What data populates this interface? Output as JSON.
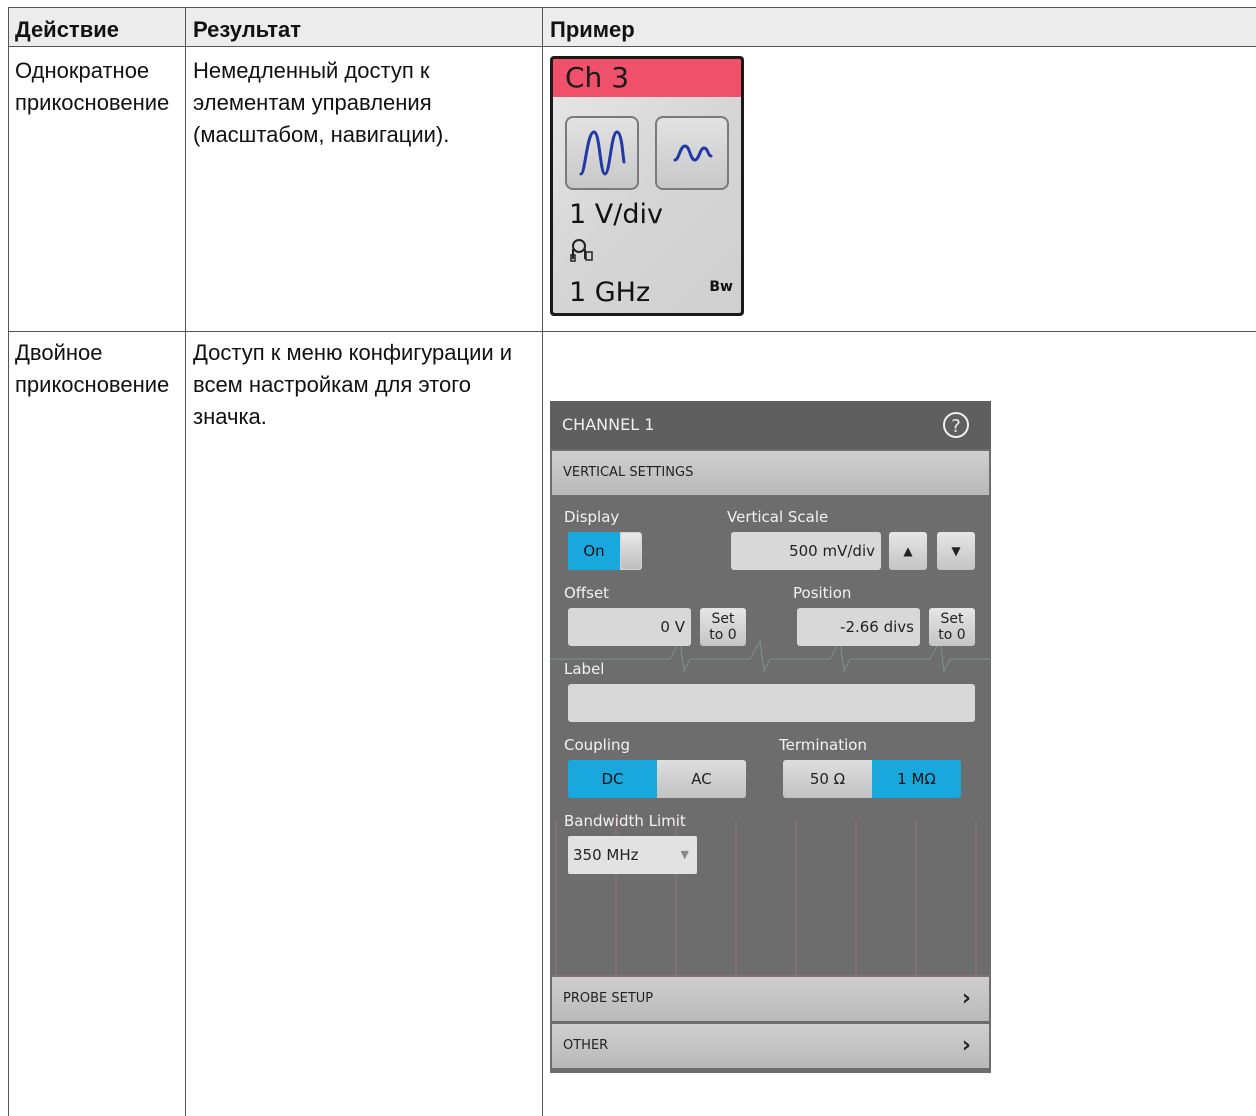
{
  "table": {
    "headers": [
      "Действие",
      "Результат",
      "Пример"
    ],
    "rows": [
      {
        "action_lines": [
          "Однократное",
          "прикосновение"
        ],
        "result_lines": [
          "Немедленный доступ к",
          "элементам управления",
          "(масштабом, навигации)."
        ]
      },
      {
        "action_lines": [
          "Двойное",
          "прикосновение"
        ],
        "result_lines": [
          "Доступ к меню конфигурации и",
          "всем настройкам для этого",
          "значка."
        ]
      }
    ]
  },
  "badge": {
    "title": "Ch 3",
    "scale": "1 V/div",
    "bandwidth": "1 GHz",
    "bw_label": "Bw",
    "title_color": "#f0506a"
  },
  "panel": {
    "title": "CHANNEL 1",
    "help_glyph": "?",
    "vertical_settings": "VERTICAL SETTINGS",
    "display_label": "Display",
    "display_on": "On",
    "vertical_scale_label": "Vertical Scale",
    "vertical_scale_value": "500 mV/div",
    "offset_label": "Offset",
    "offset_value": "0 V",
    "position_label": "Position",
    "position_value": "-2.66 divs",
    "set_line1": "Set",
    "set_line2": "to 0",
    "label_label": "Label",
    "label_value": "",
    "coupling_label": "Coupling",
    "coupling_dc": "DC",
    "coupling_ac": "AC",
    "termination_label": "Termination",
    "termination_50": "50 Ω",
    "termination_1m": "1 MΩ",
    "bandwidth_label": "Bandwidth Limit",
    "bandwidth_value": "350 MHz",
    "probe_setup": "PROBE SETUP",
    "other": "OTHER",
    "accent_color": "#19a8de"
  }
}
